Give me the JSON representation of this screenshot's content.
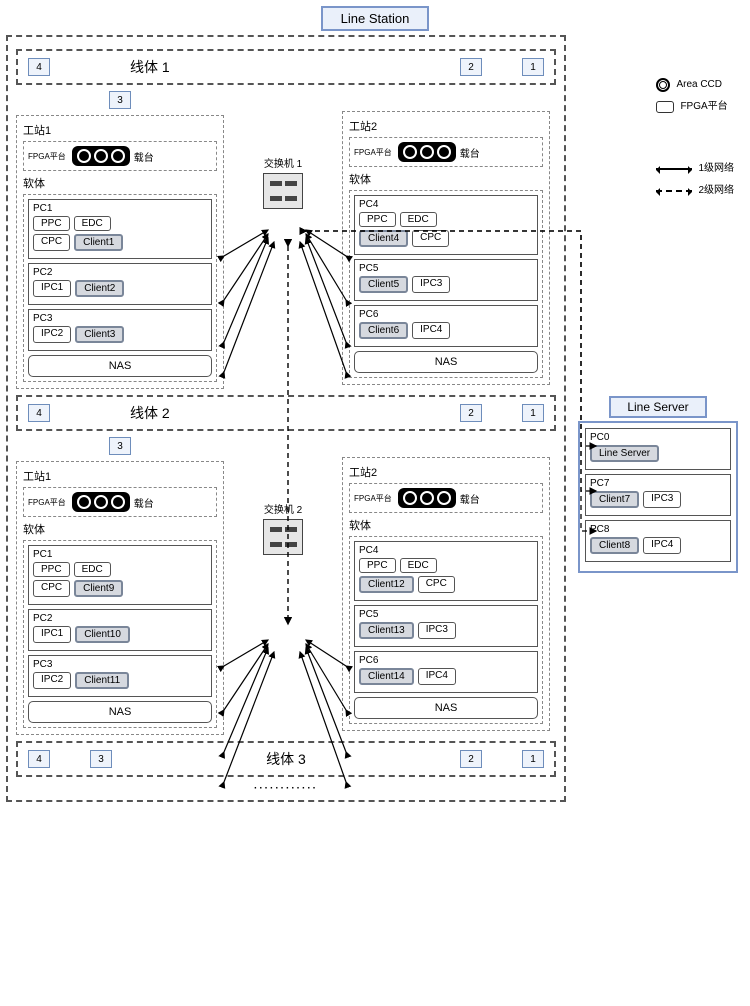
{
  "titles": {
    "line_station": "Line Station",
    "line_server": "Line Server"
  },
  "legend": {
    "area_ccd": "Area CCD",
    "fpga": "FPGA平台",
    "net1": "1级网络",
    "net2": "2级网络"
  },
  "line_bodies": {
    "lb1": "线体 1",
    "lb2": "线体 2",
    "lb3": "线体 3"
  },
  "nums": {
    "n1": "1",
    "n2": "2",
    "n3": "3",
    "n4": "4"
  },
  "labels": {
    "ws1": "工站1",
    "ws2": "工站2",
    "fpga_small": "FPGA平台",
    "carrier": "载台",
    "software": "软体",
    "switch1": "交换机 1",
    "switch2": "交换机 2",
    "nas": "NAS"
  },
  "pcs": {
    "pc0": "PC0",
    "pc1": "PC1",
    "pc2": "PC2",
    "pc3": "PC3",
    "pc4": "PC4",
    "pc5": "PC5",
    "pc6": "PC6",
    "pc7": "PC7",
    "pc8": "PC8"
  },
  "chips": {
    "ppc": "PPC",
    "edc": "EDC",
    "cpc": "CPC",
    "ipc1": "IPC1",
    "ipc2": "IPC2",
    "ipc3": "IPC3",
    "ipc4": "IPC4",
    "line_server": "Line Server",
    "c1": "Client1",
    "c2": "Client2",
    "c3": "Client3",
    "c4": "Client4",
    "c5": "Client5",
    "c6": "Client6",
    "c7": "Client7",
    "c8": "Client8",
    "c9": "Client9",
    "c10": "Client10",
    "c11": "Client11",
    "c12": "Client12",
    "c13": "Client13",
    "c14": "Client14"
  },
  "ellipsis": "············"
}
